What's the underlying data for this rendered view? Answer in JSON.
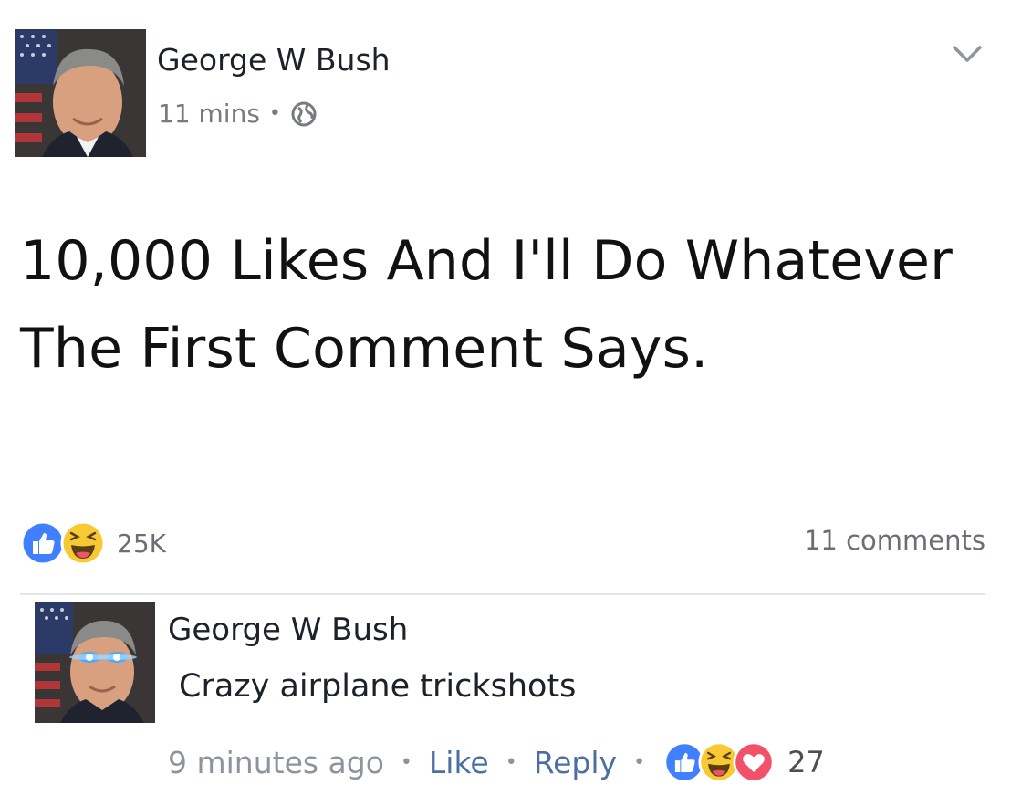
{
  "post": {
    "author": "George W Bush",
    "timestamp": "11 mins",
    "separator": "•",
    "privacy_icon": "globe-icon",
    "text": "10,000 Likes And I'll Do Whatever The First Comment Says.",
    "reactions": {
      "icons": [
        "like-icon",
        "haha-icon"
      ],
      "count": "25K"
    },
    "comments_count": "11 comments"
  },
  "comment": {
    "author": "George W Bush",
    "text": "Crazy airplane trickshots",
    "time": "9 minutes ago",
    "like_label": "Like",
    "reply_label": "Reply",
    "separator": "•",
    "reactions": {
      "icons": [
        "like-icon",
        "haha-icon",
        "love-icon"
      ],
      "count": "27"
    }
  },
  "colors": {
    "like_blue": "#4080ff",
    "haha_yellow": "#f7c935",
    "love_red": "#f25268",
    "link_blue": "#4b6fa3",
    "meta_gray": "#777b80"
  }
}
